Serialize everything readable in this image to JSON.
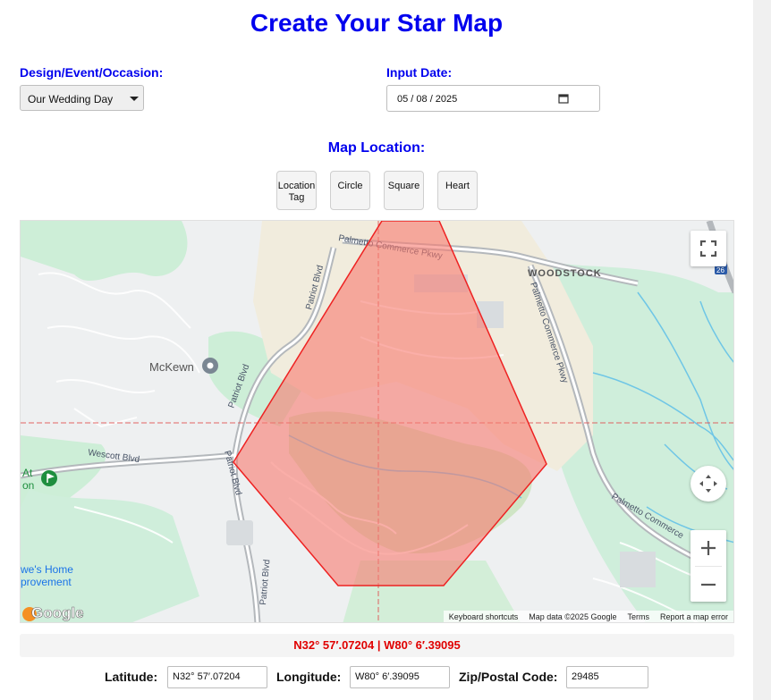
{
  "title": "Create Your Star Map",
  "design": {
    "label": "Design/Event/Occasion:",
    "selected": "Our Wedding Day"
  },
  "date": {
    "label": "Input Date:",
    "value": "05 / 08 / 2025"
  },
  "map_location": {
    "label": "Map Location:",
    "shapes": [
      {
        "label": "Location Tag"
      },
      {
        "label": "Circle"
      },
      {
        "label": "Square"
      },
      {
        "label": "Heart"
      }
    ]
  },
  "map": {
    "place_labels": {
      "woodstock": "WOODSTOCK",
      "mckewn": "McKewn",
      "palmetto_commerce_pkwy": "Palmetto Commerce Pkwy",
      "palmetto_commerce_pkwy_2": "Palmetto Commerce Pkwy",
      "palmetto_commerce_3": "Palmetto Commerce",
      "patriot_blvd_1": "Patriot Blvd",
      "patriot_blvd_2": "Patriot Blvd",
      "patriot_blvd_3": "Patriot Blvd",
      "patriot_blvd_4": "Patriot Blvd",
      "wescott_blvd": "Wescott Blvd",
      "at_on": "At\non",
      "lowes_1": "we's Home",
      "lowes_2": "provement",
      "highway_shield": "26"
    },
    "google_logo": "Google",
    "attribution": {
      "keyboard": "Keyboard shortcuts",
      "data": "Map data ©2025 Google",
      "terms": "Terms",
      "report": "Report a map error"
    },
    "shape_fill_color": "#f87a6f",
    "shape_stroke_color": "#ee2222"
  },
  "coordinates_display": "N32° 57′.07204 | W80° 6′.39095",
  "fields": {
    "latitude_label": "Latitude:",
    "latitude_value": "N32° 57′.07204",
    "longitude_label": "Longitude:",
    "longitude_value": "W80° 6′.39095",
    "zip_label": "Zip/Postal Code:",
    "zip_value": "29485"
  },
  "colors": {
    "accent": "#0000ee",
    "coordinate_text": "#e00000"
  }
}
